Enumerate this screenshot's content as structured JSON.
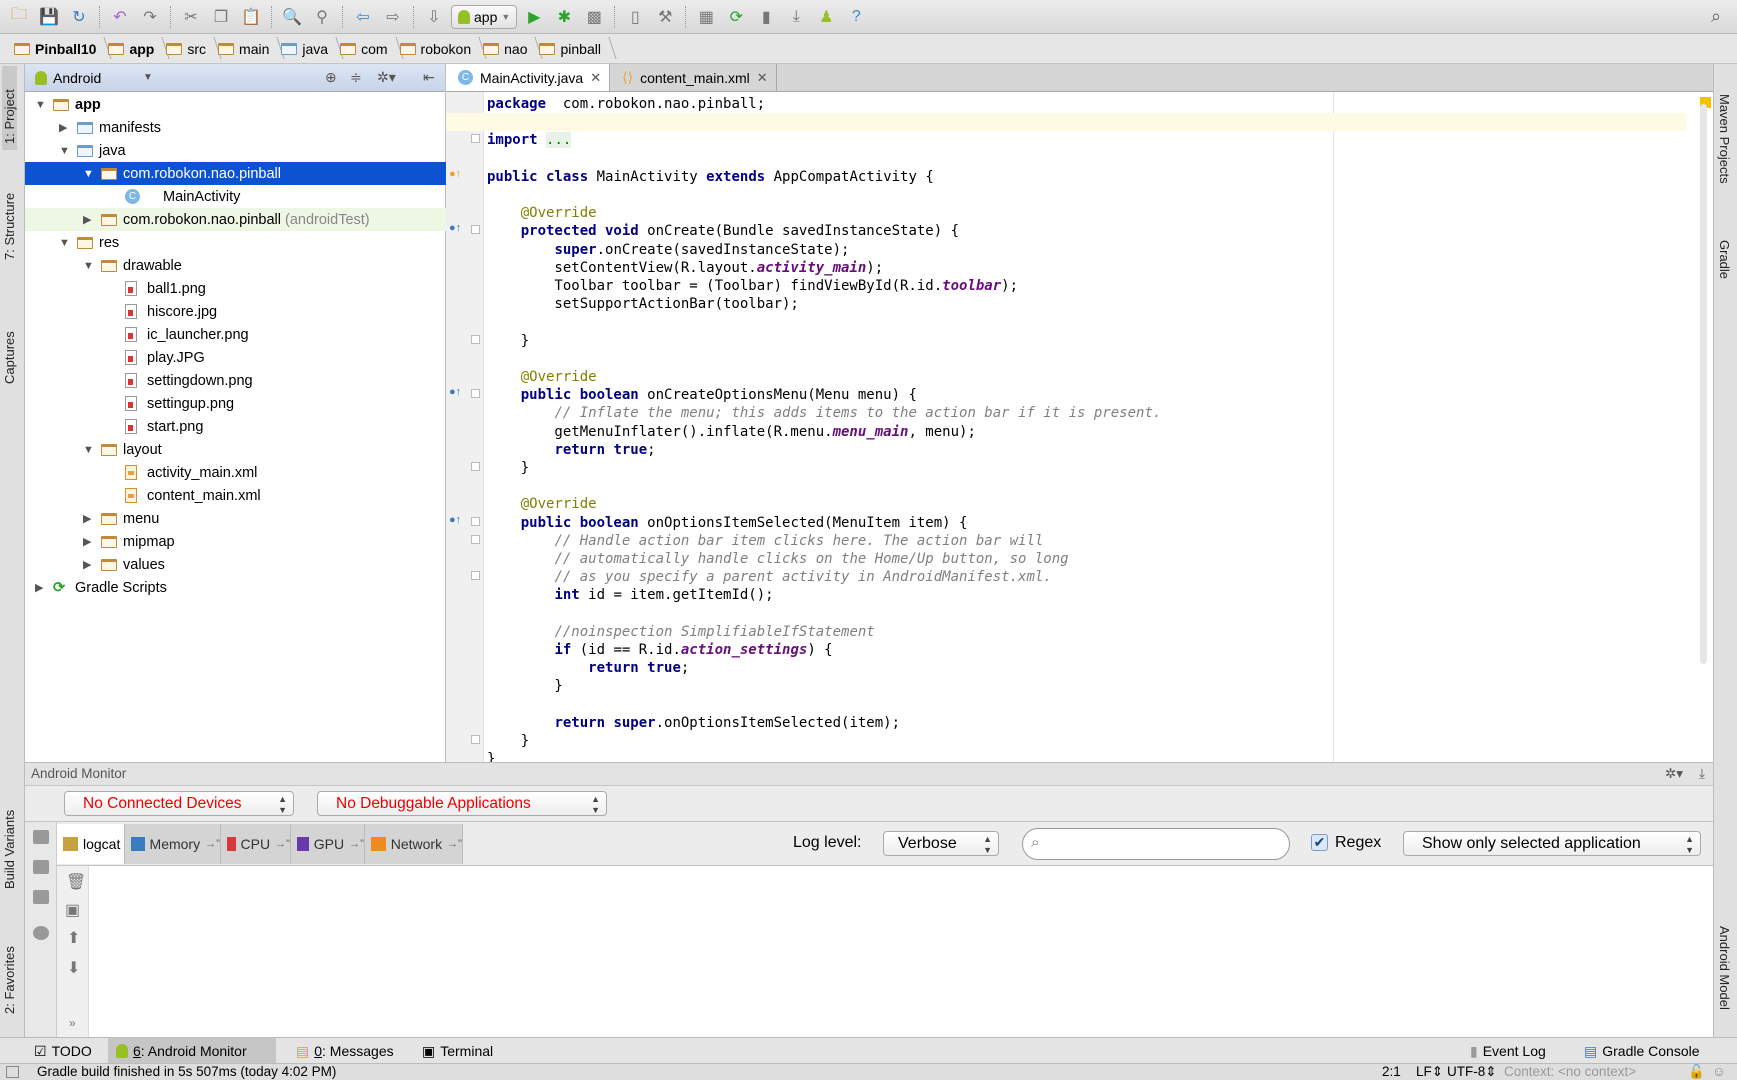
{
  "toolbar": {
    "run_config": "app",
    "icons": [
      "open-folder-icon",
      "save-icon",
      "sync-icon",
      "undo-icon",
      "redo-icon",
      "cut-icon",
      "copy-icon",
      "paste-icon",
      "find-icon",
      "replace-icon",
      "back-icon",
      "forward-icon",
      "make-project-icon",
      "run-icon",
      "debug-icon",
      "attach-icon",
      "device-icon",
      "sdk-manager-icon",
      "project-structure-icon",
      "gradle-sync-icon",
      "avd-manager-icon",
      "sdk-download-icon",
      "android-icon",
      "help-icon"
    ]
  },
  "breadcrumbs": [
    "Pinball10",
    "app",
    "src",
    "main",
    "java",
    "com",
    "robokon",
    "nao",
    "pinball"
  ],
  "left_stripe": {
    "project": "1: Project",
    "structure": "7: Structure",
    "captures": "Captures",
    "build_variants": "Build Variants",
    "favorites": "2: Favorites"
  },
  "right_stripe": {
    "maven": "Maven Projects",
    "gradle": "Gradle",
    "android_model": "Android Model"
  },
  "project_panel": {
    "view": "Android",
    "tree": [
      {
        "label": "app",
        "depth": 0,
        "icon": "module",
        "arrow": "down",
        "bold": true
      },
      {
        "label": "manifests",
        "depth": 1,
        "icon": "folder-blue",
        "arrow": "right"
      },
      {
        "label": "java",
        "depth": 1,
        "icon": "folder-blue",
        "arrow": "down"
      },
      {
        "label": "com.robokon.nao.pinball",
        "depth": 2,
        "icon": "package",
        "arrow": "down",
        "selected": true
      },
      {
        "label": "MainActivity",
        "depth": 3,
        "icon": "class"
      },
      {
        "label": "com.robokon.nao.pinball",
        "secondary": "(androidTest)",
        "depth": 2,
        "icon": "package",
        "arrow": "right",
        "test": true
      },
      {
        "label": "res",
        "depth": 1,
        "icon": "folder",
        "arrow": "down"
      },
      {
        "label": "drawable",
        "depth": 2,
        "icon": "package",
        "arrow": "down"
      },
      {
        "label": "ball1.png",
        "depth": 3,
        "icon": "image"
      },
      {
        "label": "hiscore.jpg",
        "depth": 3,
        "icon": "image"
      },
      {
        "label": "ic_launcher.png",
        "depth": 3,
        "icon": "image"
      },
      {
        "label": "play.JPG",
        "depth": 3,
        "icon": "image"
      },
      {
        "label": "settingdown.png",
        "depth": 3,
        "icon": "image"
      },
      {
        "label": "settingup.png",
        "depth": 3,
        "icon": "image"
      },
      {
        "label": "start.png",
        "depth": 3,
        "icon": "image"
      },
      {
        "label": "layout",
        "depth": 2,
        "icon": "package",
        "arrow": "down"
      },
      {
        "label": "activity_main.xml",
        "depth": 3,
        "icon": "xml"
      },
      {
        "label": "content_main.xml",
        "depth": 3,
        "icon": "xml"
      },
      {
        "label": "menu",
        "depth": 2,
        "icon": "package",
        "arrow": "right"
      },
      {
        "label": "mipmap",
        "depth": 2,
        "icon": "package",
        "arrow": "right"
      },
      {
        "label": "values",
        "depth": 2,
        "icon": "package",
        "arrow": "right"
      },
      {
        "label": "Gradle Scripts",
        "depth": 0,
        "icon": "gradle",
        "arrow": "right"
      }
    ]
  },
  "editor": {
    "tabs": [
      {
        "label": "MainActivity.java",
        "active": true,
        "icon": "class-icon"
      },
      {
        "label": "content_main.xml",
        "active": false,
        "icon": "xml-icon"
      }
    ],
    "lines": [
      [
        [
          "kw",
          "package"
        ],
        [
          "",
          "  com.robokon.nao.pinball;"
        ]
      ],
      [],
      [
        [
          "kw",
          "import"
        ],
        [
          "",
          " "
        ],
        [
          "fold2",
          "..."
        ]
      ],
      [],
      [
        [
          "kw",
          "public class"
        ],
        [
          "",
          " MainActivity "
        ],
        [
          "kw",
          "extends"
        ],
        [
          "",
          " AppCompatActivity {"
        ]
      ],
      [],
      [
        [
          "",
          "    "
        ],
        [
          "ann",
          "@Override"
        ]
      ],
      [
        [
          "",
          "    "
        ],
        [
          "kw",
          "protected void"
        ],
        [
          "",
          " onCreate(Bundle savedInstanceState) {"
        ]
      ],
      [
        [
          "",
          "        "
        ],
        [
          "kw",
          "super"
        ],
        [
          "",
          ".onCreate(savedInstanceState);"
        ]
      ],
      [
        [
          "",
          "        setContentView(R.layout."
        ],
        [
          "fld",
          "activity_main"
        ],
        [
          "",
          ");"
        ]
      ],
      [
        [
          "",
          "        Toolbar toolbar = (Toolbar) findViewById(R.id."
        ],
        [
          "fld",
          "toolbar"
        ],
        [
          "",
          ");"
        ]
      ],
      [
        [
          "",
          "        setSupportActionBar(toolbar);"
        ]
      ],
      [],
      [
        [
          "",
          "    }"
        ]
      ],
      [],
      [
        [
          "",
          "    "
        ],
        [
          "ann",
          "@Override"
        ]
      ],
      [
        [
          "",
          "    "
        ],
        [
          "kw",
          "public boolean"
        ],
        [
          "",
          " onCreateOptionsMenu(Menu menu) {"
        ]
      ],
      [
        [
          "",
          "        "
        ],
        [
          "cm",
          "// Inflate the menu; this adds items to the action bar if it is present."
        ]
      ],
      [
        [
          "",
          "        getMenuInflater().inflate(R.menu."
        ],
        [
          "fld",
          "menu_main"
        ],
        [
          "",
          ", menu);"
        ]
      ],
      [
        [
          "",
          "        "
        ],
        [
          "kw",
          "return true"
        ],
        [
          "",
          ";"
        ]
      ],
      [
        [
          "",
          "    }"
        ]
      ],
      [],
      [
        [
          "",
          "    "
        ],
        [
          "ann",
          "@Override"
        ]
      ],
      [
        [
          "",
          "    "
        ],
        [
          "kw",
          "public boolean"
        ],
        [
          "",
          " onOptionsItemSelected(MenuItem item) {"
        ]
      ],
      [
        [
          "",
          "        "
        ],
        [
          "cm",
          "// Handle action bar item clicks here. The action bar will"
        ]
      ],
      [
        [
          "",
          "        "
        ],
        [
          "cm",
          "// automatically handle clicks on the Home/Up button, so long"
        ]
      ],
      [
        [
          "",
          "        "
        ],
        [
          "cm",
          "// as you specify a parent activity in AndroidManifest.xml."
        ]
      ],
      [
        [
          "",
          "        "
        ],
        [
          "kw",
          "int"
        ],
        [
          "",
          " id = item.getItemId();"
        ]
      ],
      [],
      [
        [
          "",
          "        "
        ],
        [
          "cm",
          "//noinspection SimplifiableIfStatement"
        ]
      ],
      [
        [
          "",
          "        "
        ],
        [
          "kw",
          "if"
        ],
        [
          "",
          " (id == R.id."
        ],
        [
          "fld",
          "action_settings"
        ],
        [
          "",
          ") {"
        ]
      ],
      [
        [
          "",
          "            "
        ],
        [
          "kw",
          "return true"
        ],
        [
          "",
          ";"
        ]
      ],
      [
        [
          "",
          "        }"
        ]
      ],
      [],
      [
        [
          "",
          "        "
        ],
        [
          "kw",
          "return super"
        ],
        [
          "",
          ".onOptionsItemSelected(item);"
        ]
      ],
      [
        [
          "",
          "    }"
        ]
      ],
      [
        [
          "",
          "}"
        ]
      ]
    ]
  },
  "monitor": {
    "title": "Android Monitor",
    "device": "No Connected Devices",
    "app": "No Debuggable Applications",
    "tabs": [
      "logcat",
      "Memory",
      "CPU",
      "GPU",
      "Network"
    ],
    "tab_colors": [
      "#c8a040",
      "#3a7cc0",
      "#d83a3a",
      "#6a3aa8",
      "#f08a20"
    ],
    "log_level_label": "Log level:",
    "log_level": "Verbose",
    "search_value": "",
    "regex_label": "Regex",
    "regex_checked": true,
    "filter": "Show only selected application"
  },
  "bottom_bar": {
    "todo": "TODO",
    "monitor_num": "6",
    "monitor": ": Android Monitor",
    "messages_num": "0",
    "messages": ": Messages",
    "terminal": "Terminal",
    "event_log": "Event Log",
    "gradle_console": "Gradle Console"
  },
  "status": {
    "message": "Gradle build finished in 5s 507ms (today 4:02 PM)",
    "position": "2:1",
    "line_sep": "LF",
    "encoding": "UTF-8",
    "context": "Context: <no context>"
  },
  "colors": {
    "selection": "#0d52d0",
    "keyword": "#000080",
    "annotation": "#808000",
    "field": "#660e7a",
    "error_text": "#e00000"
  }
}
